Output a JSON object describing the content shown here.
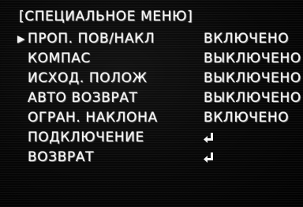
{
  "menu": {
    "title": "[СПЕЦИАЛЬНОЕ МЕНЮ]",
    "cursor_glyph": "▶",
    "items": [
      {
        "label": "ПРОП. ПОВ/НАКЛ",
        "value": "ВКЛЮЧЕНО",
        "selected": true
      },
      {
        "label": "КОМПАС",
        "value": "ВЫКЛЮЧЕНО"
      },
      {
        "label": "ИСХОД. ПОЛОЖ",
        "value": "ВЫКЛЮЧЕНО"
      },
      {
        "label": "АВТО ВОЗВРАТ",
        "value": "ВЫКЛЮЧЕНО"
      },
      {
        "label": "ОГРАН. НАКЛОНА",
        "value": "ВКЛЮЧЕНО"
      },
      {
        "label": "ПОДКЛЮЧЕНИЕ",
        "icon": "enter-icon"
      },
      {
        "label": "ВОЗВРАТ",
        "icon": "enter-icon"
      }
    ]
  }
}
